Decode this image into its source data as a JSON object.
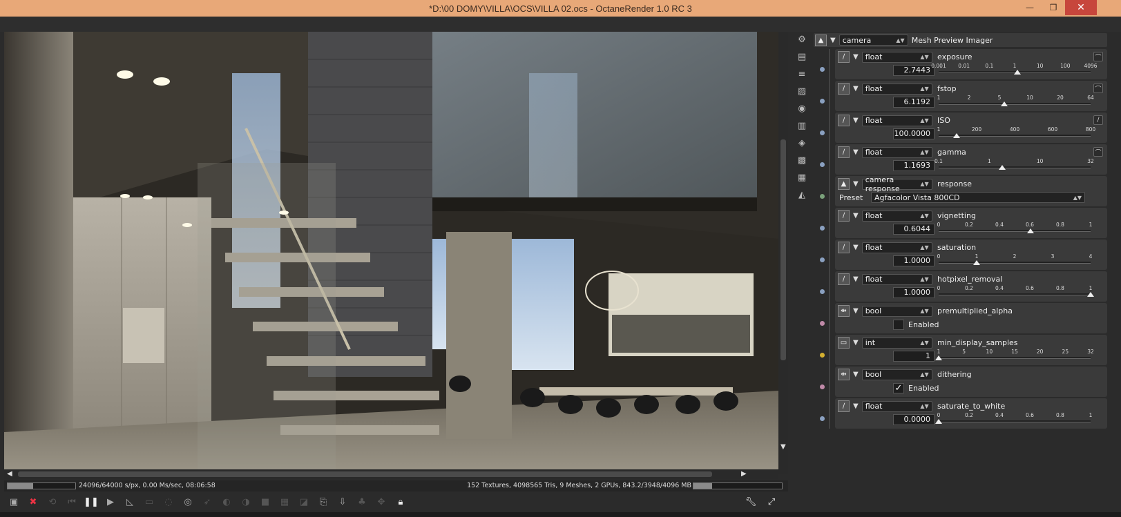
{
  "window": {
    "title": "*D:\\00 DOMY\\VILLA\\OCS\\VILLA 02.ocs - OctaneRender 1.0 RC 3",
    "minimize": "—",
    "restore": "❐",
    "close": "✕"
  },
  "status": {
    "left": "24096/64000 s/px, 0.00 Ms/sec, 08:06:58",
    "right": "152 Textures, 4098565 Tris, 9 Meshes, 2 GPUs, 843.2/3948/4096 MB",
    "samples_progress": 0.38,
    "memory_progress": 0.21
  },
  "inspector": {
    "node_type": "camera",
    "node_title": "Mesh Preview Imager",
    "params": [
      {
        "type": "float",
        "name": "exposure",
        "value": "2.7443",
        "ticks": [
          "0.001",
          "0.01",
          "0.1",
          "1",
          "10",
          "100",
          "4096"
        ],
        "level": 0.52,
        "curve": "log"
      },
      {
        "type": "float",
        "name": "fstop",
        "value": "6.1192",
        "ticks": [
          "1",
          "2",
          "5",
          "10",
          "20",
          "64"
        ],
        "level": 0.43,
        "curve": "log"
      },
      {
        "type": "float",
        "name": "ISO",
        "value": "100.0000",
        "ticks": [
          "1",
          "200",
          "400",
          "600",
          "800"
        ],
        "level": 0.12,
        "curve": "lin"
      },
      {
        "type": "float",
        "name": "gamma",
        "value": "1.1693",
        "ticks": [
          "0.1",
          "1",
          "10",
          "32"
        ],
        "level": 0.42,
        "curve": "log"
      },
      {
        "type": "camera response",
        "name": "response",
        "preset_label": "Preset",
        "preset": "Agfacolor Vista 800CD",
        "kind": "preset"
      },
      {
        "type": "float",
        "name": "vignetting",
        "value": "0.6044",
        "ticks": [
          "0",
          "0.2",
          "0.4",
          "0.6",
          "0.8",
          "1"
        ],
        "level": 0.6044
      },
      {
        "type": "float",
        "name": "saturation",
        "value": "1.0000",
        "ticks": [
          "0",
          "1",
          "2",
          "3",
          "4"
        ],
        "level": 0.25
      },
      {
        "type": "float",
        "name": "hotpixel_removal",
        "value": "1.0000",
        "ticks": [
          "0",
          "0.2",
          "0.4",
          "0.6",
          "0.8",
          "1"
        ],
        "level": 1.0
      },
      {
        "type": "bool",
        "name": "premultiplied_alpha",
        "check_label": "Enabled",
        "checked": false,
        "kind": "bool"
      },
      {
        "type": "int",
        "name": "min_display_samples",
        "value": "1",
        "ticks": [
          "1",
          "5",
          "10",
          "15",
          "20",
          "25",
          "32"
        ],
        "level": 0.0
      },
      {
        "type": "bool",
        "name": "dithering",
        "check_label": "Enabled",
        "checked": true,
        "kind": "bool"
      },
      {
        "type": "float",
        "name": "saturate_to_white",
        "value": "0.0000",
        "ticks": [
          "0",
          "0.2",
          "0.4",
          "0.6",
          "0.8",
          "1"
        ],
        "level": 0.0
      }
    ]
  },
  "colors": {
    "pin_float": "#8aa0c0",
    "pin_response": "#7aa07a",
    "pin_bool": "#c08aa8",
    "pin_int": "#d4b030"
  }
}
